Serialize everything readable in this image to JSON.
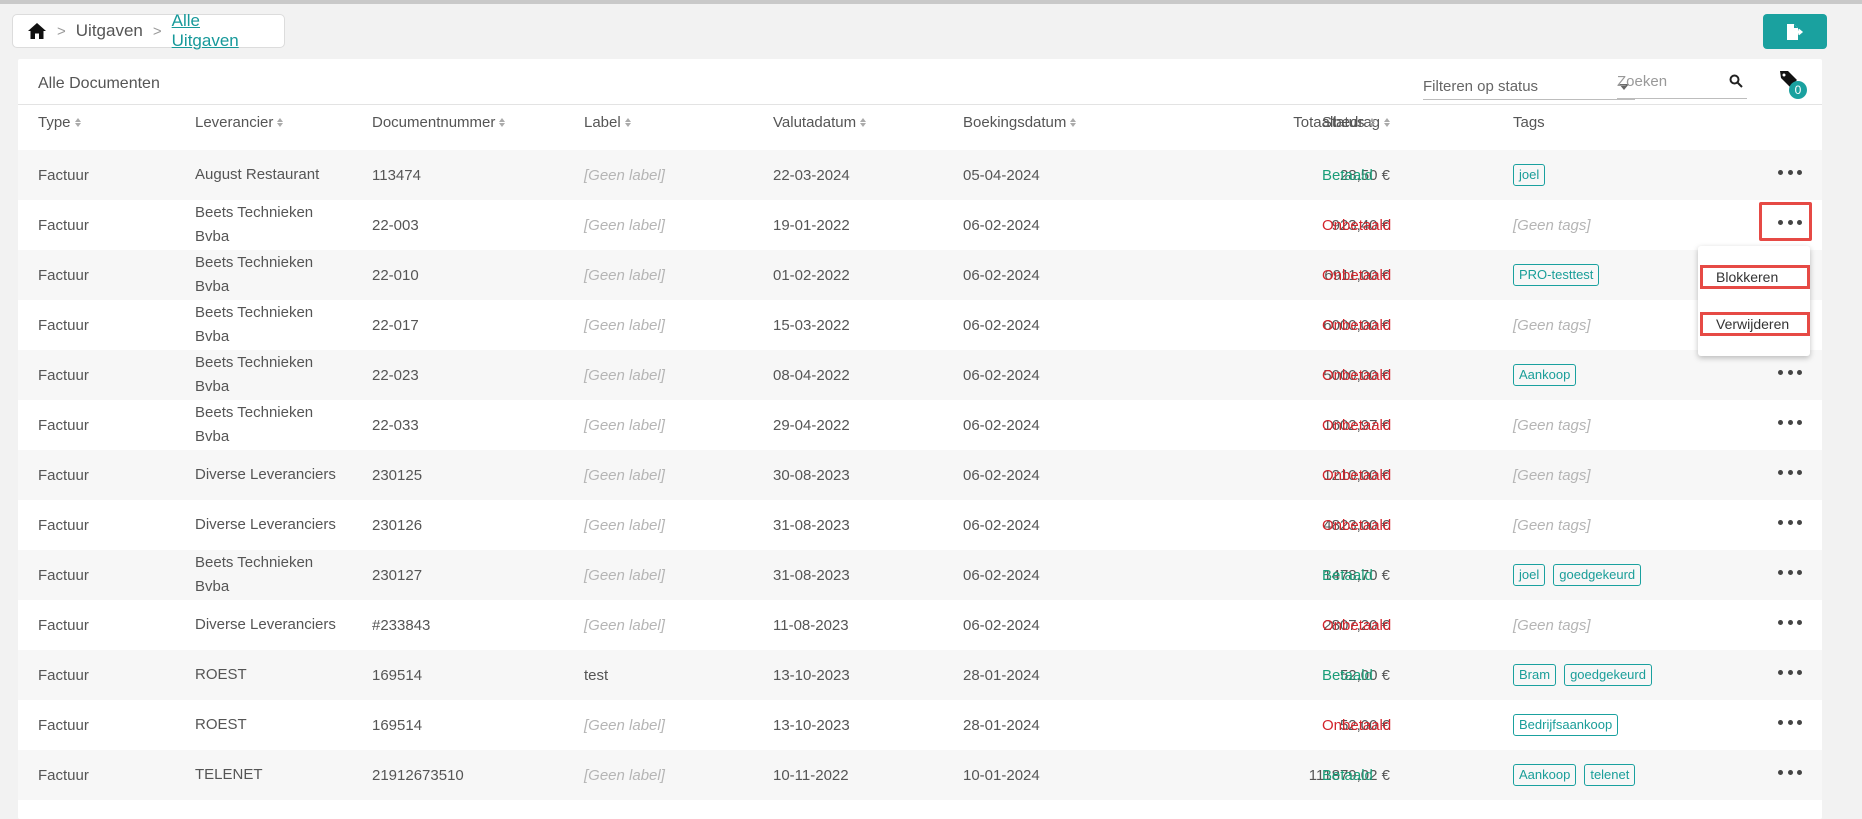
{
  "breadcrumb": {
    "items": [
      "Uitgaven",
      "Alle Uitgaven"
    ]
  },
  "toolbar": {
    "title": "Alle Documenten",
    "filter_placeholder": "Filteren op status",
    "search_placeholder": "Zoeken",
    "tag_count": "0"
  },
  "columns": [
    "Type",
    "Leverancier",
    "Documentnummer",
    "Label",
    "Valutadatum",
    "Boekingsdatum",
    "Totaalbedrag",
    "Status",
    "Tags"
  ],
  "rows": [
    {
      "type": "Factuur",
      "supplier": [
        "August Restaurant"
      ],
      "docnr": "113474",
      "label": "[Geen label]",
      "valuta": "22-03-2024",
      "booking": "05-04-2024",
      "amount": "28,50 €",
      "status": "Betaald",
      "tags": [
        "joel"
      ]
    },
    {
      "type": "Factuur",
      "supplier": [
        "Beets Technieken",
        "Bvba"
      ],
      "docnr": "22-003",
      "label": "[Geen label]",
      "valuta": "19-01-2022",
      "booking": "06-02-2024",
      "amount": "923,40 €",
      "status": "Onbetaald",
      "tags": [],
      "no_tags": "[Geen tags]"
    },
    {
      "type": "Factuur",
      "supplier": [
        "Beets Technieken",
        "Bvba"
      ],
      "docnr": "22-010",
      "label": "[Geen label]",
      "valuta": "01-02-2022",
      "booking": "06-02-2024",
      "amount": "6911,00 €",
      "status": "Onbetaald",
      "tags": [
        "PRO-testtest"
      ]
    },
    {
      "type": "Factuur",
      "supplier": [
        "Beets Technieken",
        "Bvba"
      ],
      "docnr": "22-017",
      "label": "[Geen label]",
      "valuta": "15-03-2022",
      "booking": "06-02-2024",
      "amount": "6000,00 €",
      "status": "Onbetaald",
      "tags": [],
      "no_tags": "[Geen tags]"
    },
    {
      "type": "Factuur",
      "supplier": [
        "Beets Technieken",
        "Bvba"
      ],
      "docnr": "22-023",
      "label": "[Geen label]",
      "valuta": "08-04-2022",
      "booking": "06-02-2024",
      "amount": "5000,00 €",
      "status": "Onbetaald",
      "tags": [
        "Aankoop"
      ]
    },
    {
      "type": "Factuur",
      "supplier": [
        "Beets Technieken",
        "Bvba"
      ],
      "docnr": "22-033",
      "label": "[Geen label]",
      "valuta": "29-04-2022",
      "booking": "06-02-2024",
      "amount": "1602,97 €",
      "status": "Onbetaald",
      "tags": [],
      "no_tags": "[Geen tags]"
    },
    {
      "type": "Factuur",
      "supplier": [
        "Diverse Leveranciers"
      ],
      "docnr": "230125",
      "label": "[Geen label]",
      "valuta": "30-08-2023",
      "booking": "06-02-2024",
      "amount": "1210,00 €",
      "status": "Onbetaald",
      "tags": [],
      "no_tags": "[Geen tags]"
    },
    {
      "type": "Factuur",
      "supplier": [
        "Diverse Leveranciers"
      ],
      "docnr": "230126",
      "label": "[Geen label]",
      "valuta": "31-08-2023",
      "booking": "06-02-2024",
      "amount": "4823,00 €",
      "status": "Onbetaald",
      "tags": [],
      "no_tags": "[Geen tags]"
    },
    {
      "type": "Factuur",
      "supplier": [
        "Beets Technieken",
        "Bvba"
      ],
      "docnr": "230127",
      "label": "[Geen label]",
      "valuta": "31-08-2023",
      "booking": "06-02-2024",
      "amount": "1478,70 €",
      "status": "Betaald",
      "tags": [
        "joel",
        "goedgekeurd"
      ]
    },
    {
      "type": "Factuur",
      "supplier": [
        "Diverse Leveranciers"
      ],
      "docnr": "#233843",
      "label": "[Geen label]",
      "valuta": "11-08-2023",
      "booking": "06-02-2024",
      "amount": "2807,20 €",
      "status": "Onbetaald",
      "tags": [],
      "no_tags": "[Geen tags]"
    },
    {
      "type": "Factuur",
      "supplier": [
        "ROEST"
      ],
      "docnr": "169514",
      "label": "test",
      "valuta": "13-10-2023",
      "booking": "28-01-2024",
      "amount": "52,00 €",
      "status": "Betaald",
      "tags": [
        "Bram",
        "goedgekeurd"
      ]
    },
    {
      "type": "Factuur",
      "supplier": [
        "ROEST"
      ],
      "docnr": "169514",
      "label": "[Geen label]",
      "valuta": "13-10-2023",
      "booking": "28-01-2024",
      "amount": "52,00 €",
      "status": "Onbetaald",
      "tags": [
        "Bedrijfsaankoop"
      ]
    },
    {
      "type": "Factuur",
      "supplier": [
        "TELENET"
      ],
      "docnr": "21912673510",
      "label": "[Geen label]",
      "valuta": "10-11-2022",
      "booking": "10-01-2024",
      "amount": "111879,02 €",
      "status": "Betaald",
      "tags": [
        "Aankoop",
        "telenet"
      ]
    }
  ],
  "dropdown": {
    "items": [
      "Blokkeren",
      "Verwijderen"
    ]
  },
  "colors": {
    "accent": "#1aa19f",
    "paid": "#1a9e79",
    "unpaid": "#d2232a",
    "highlight": "#e64a45"
  }
}
